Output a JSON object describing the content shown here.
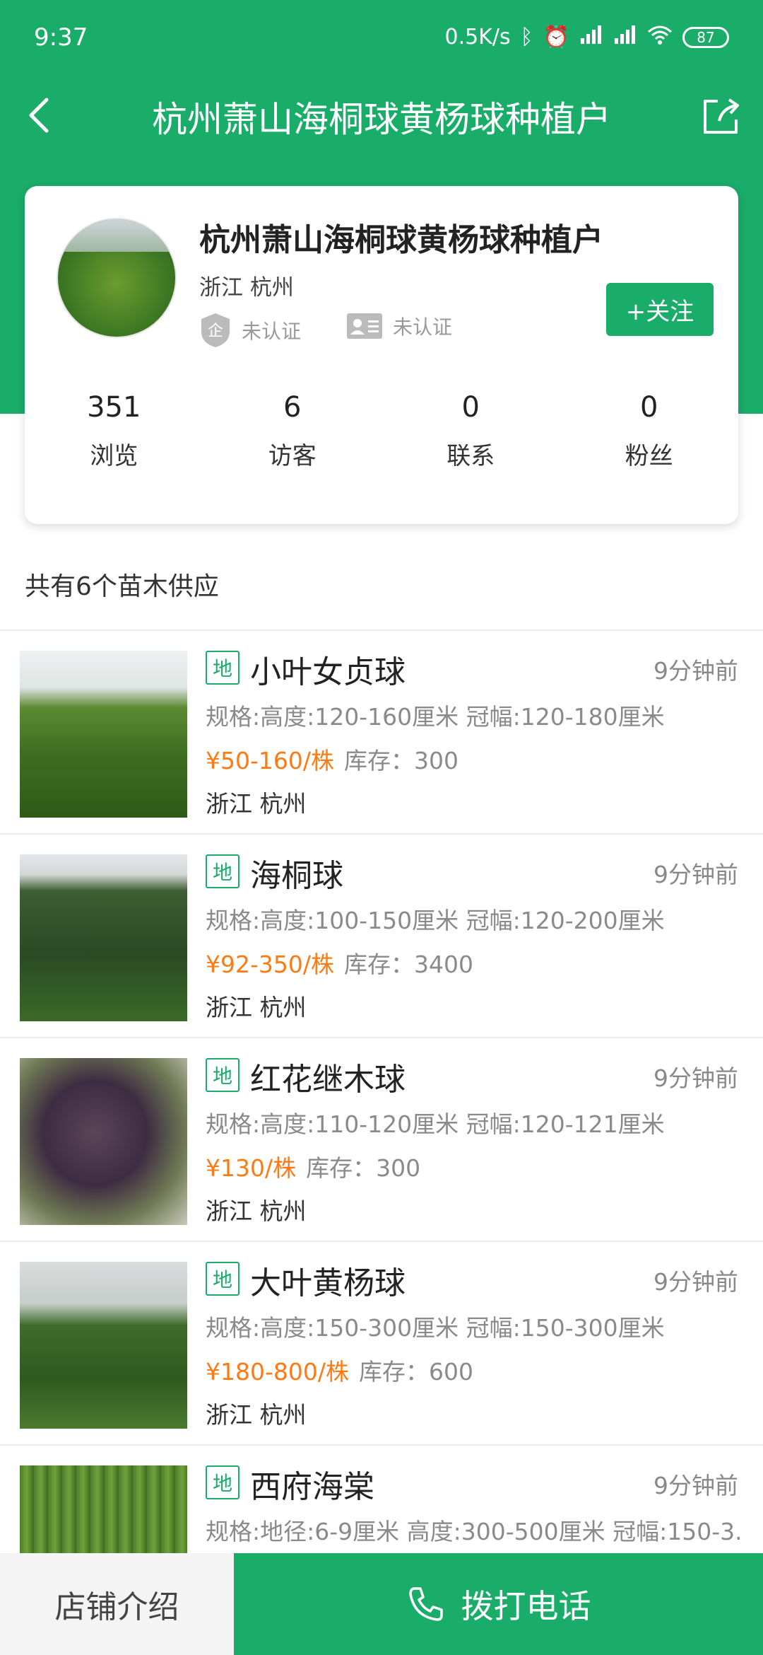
{
  "status_bar": {
    "time": "9:37",
    "speed": "0.5K/s",
    "battery": "87"
  },
  "nav": {
    "title": "杭州萧山海桐球黄杨球种植户"
  },
  "profile": {
    "name": "杭州萧山海桐球黄杨球种植户",
    "location": "浙江 杭州",
    "cert_company": "未认证",
    "cert_person": "未认证",
    "follow_label": "+关注",
    "stats": [
      {
        "value": "351",
        "label": "浏览"
      },
      {
        "value": "6",
        "label": "访客"
      },
      {
        "value": "0",
        "label": "联系"
      },
      {
        "value": "0",
        "label": "粉丝"
      }
    ]
  },
  "supply": {
    "summary": "共有6个苗木供应",
    "items": [
      {
        "badge": "地",
        "title": "小叶女贞球",
        "time": "9分钟前",
        "spec": "规格:高度:120-160厘米  冠幅:120-180厘米",
        "price": "¥50-160/株",
        "stock": "库存：300",
        "location": "浙江 杭州"
      },
      {
        "badge": "地",
        "title": "海桐球",
        "time": "9分钟前",
        "spec": "规格:高度:100-150厘米  冠幅:120-200厘米",
        "price": "¥92-350/株",
        "stock": "库存：3400",
        "location": "浙江 杭州"
      },
      {
        "badge": "地",
        "title": "红花继木球",
        "time": "9分钟前",
        "spec": "规格:高度:110-120厘米  冠幅:120-121厘米",
        "price": "¥130/株",
        "stock": "库存：300",
        "location": "浙江 杭州"
      },
      {
        "badge": "地",
        "title": "大叶黄杨球",
        "time": "9分钟前",
        "spec": "规格:高度:150-300厘米  冠幅:150-300厘米",
        "price": "¥180-800/株",
        "stock": "库存：600",
        "location": "浙江 杭州"
      },
      {
        "badge": "地",
        "title": "西府海棠",
        "time": "9分钟前",
        "spec": "规格:地径:6-9厘米  高度:300-500厘米  冠幅:150-3.",
        "price": "",
        "stock": "",
        "location": ""
      }
    ]
  },
  "bottom": {
    "shop_intro": "店铺介绍",
    "call": "拨打电话"
  },
  "colors": {
    "brand_green": "#1aad6a",
    "price_orange": "#ff7a12"
  }
}
